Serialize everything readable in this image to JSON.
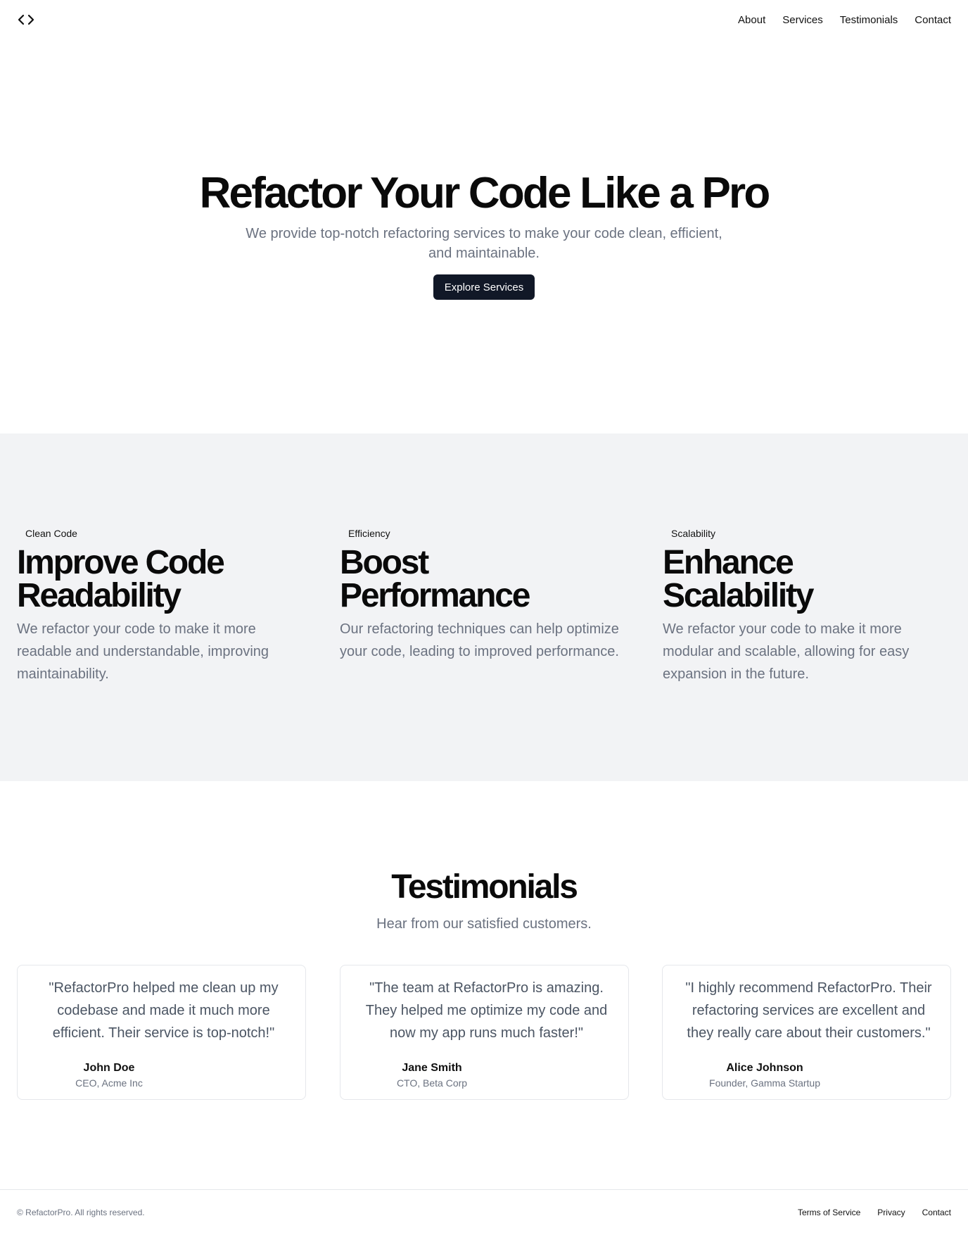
{
  "header": {
    "logo_icon": "code-brackets-icon",
    "nav": [
      {
        "label": "About"
      },
      {
        "label": "Services"
      },
      {
        "label": "Testimonials"
      },
      {
        "label": "Contact"
      }
    ]
  },
  "hero": {
    "title": "Refactor Your Code Like a Pro",
    "subtitle": "We provide top-notch refactoring services to make your code clean, efficient, and maintainable.",
    "cta_label": "Explore Services"
  },
  "features": [
    {
      "tag": "Clean Code",
      "title": "Improve Code Readability",
      "description": "We refactor your code to make it more readable and understandable, improving maintainability."
    },
    {
      "tag": "Efficiency",
      "title": "Boost Performance",
      "description": "Our refactoring techniques can help optimize your code, leading to improved performance."
    },
    {
      "tag": "Scalability",
      "title": "Enhance Scalability",
      "description": "We refactor your code to make it more modular and scalable, allowing for easy expansion in the future."
    }
  ],
  "testimonials": {
    "title": "Testimonials",
    "subtitle": "Hear from our satisfied customers.",
    "items": [
      {
        "quote": "\"RefactorPro helped me clean up my codebase and made it much more efficient. Their service is top-notch!\"",
        "name": "John Doe",
        "role": "CEO, Acme Inc"
      },
      {
        "quote": "\"The team at RefactorPro is amazing. They helped me optimize my code and now my app runs much faster!\"",
        "name": "Jane Smith",
        "role": "CTO, Beta Corp"
      },
      {
        "quote": "\"I highly recommend RefactorPro. Their refactoring services are excellent and they really care about their customers.\"",
        "name": "Alice Johnson",
        "role": "Founder, Gamma Startup"
      }
    ]
  },
  "footer": {
    "copyright": "© RefactorPro. All rights reserved.",
    "links": [
      {
        "label": "Terms of Service"
      },
      {
        "label": "Privacy"
      },
      {
        "label": "Contact"
      }
    ]
  },
  "colors": {
    "primary_button": "#111827",
    "muted_text": "#6b7280",
    "section_bg": "#f2f3f5",
    "border": "#e5e7eb"
  }
}
